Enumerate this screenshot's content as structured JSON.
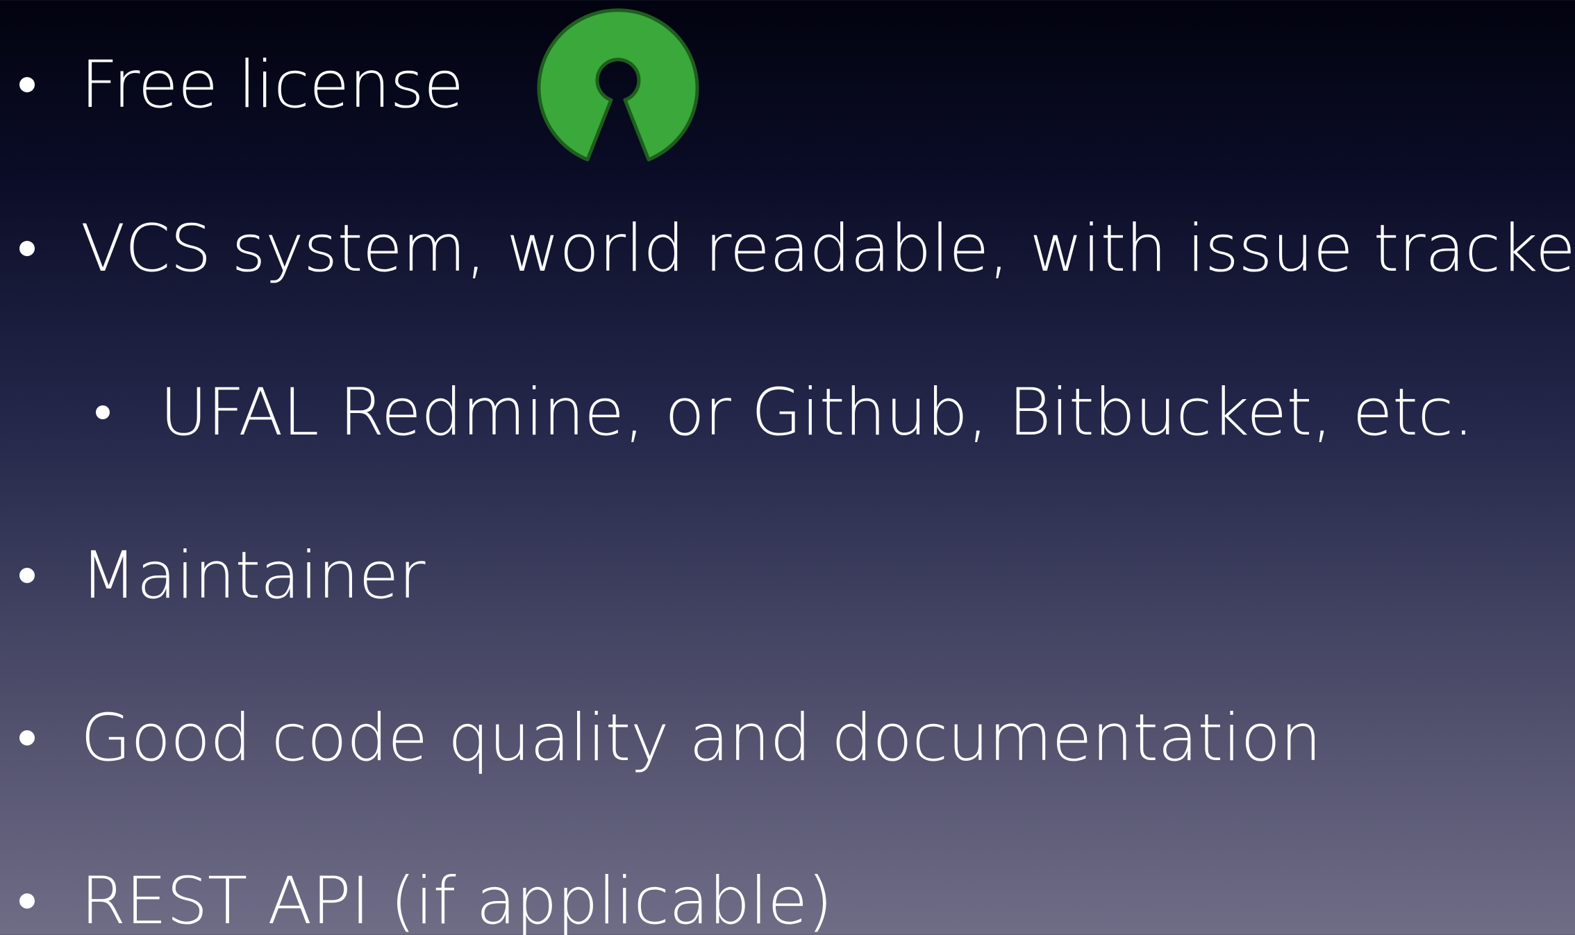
{
  "slide": {
    "bullets": [
      {
        "text": "Free license",
        "level": 1
      },
      {
        "text": "VCS system, world readable, with issue tracker",
        "level": 1
      },
      {
        "text": "UFAL Redmine, or Github, Bitbucket, etc.",
        "level": 2
      },
      {
        "text": "Maintainer",
        "level": 1
      },
      {
        "text": "Good code quality and documentation",
        "level": 1
      },
      {
        "text": "REST API (if applicable)",
        "level": 1
      }
    ],
    "logo": {
      "icon": "open-source-keyhole-logo",
      "color": "#3aa83a",
      "outline_color": "#1e5e1e"
    }
  }
}
